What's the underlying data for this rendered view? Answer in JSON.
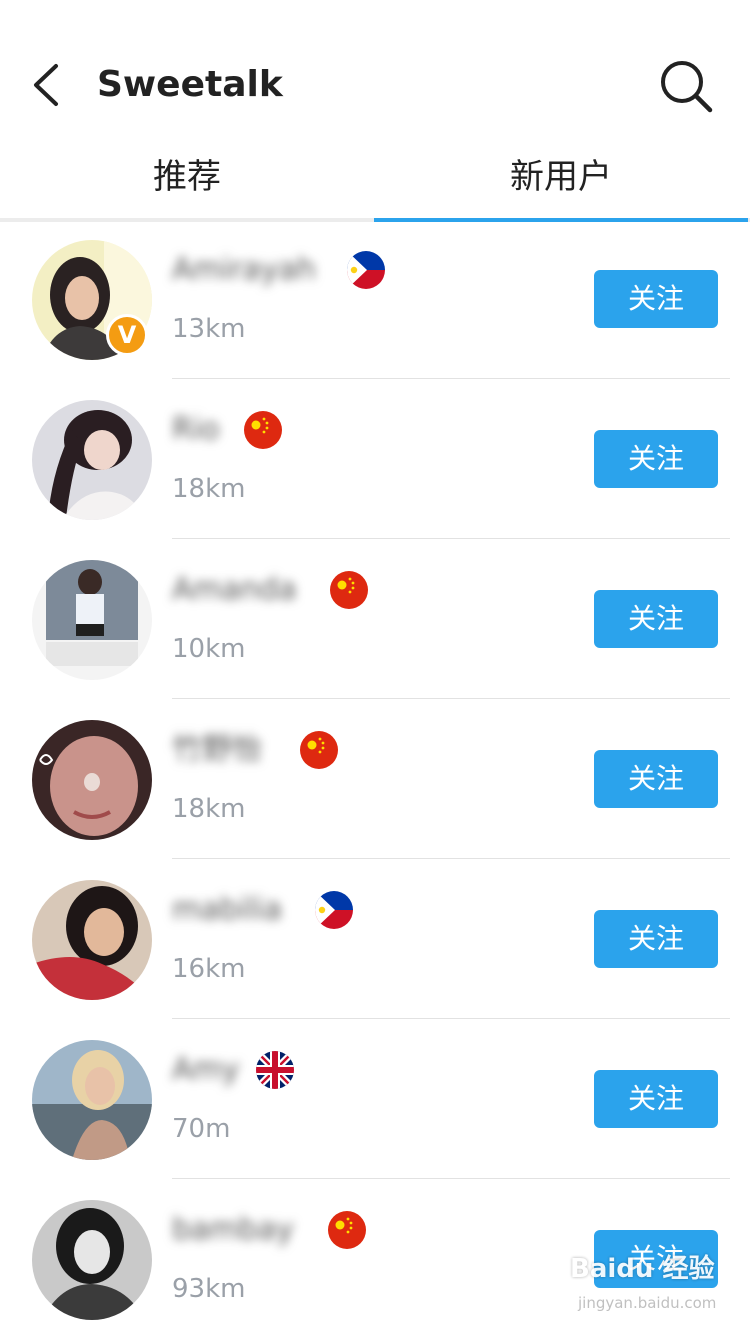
{
  "header": {
    "title": "Sweetalk"
  },
  "tabs": [
    {
      "label": "推荐"
    },
    {
      "label": "新用户"
    }
  ],
  "users": [
    {
      "name": "Amirayah",
      "flag": "philippines",
      "distance": "13km",
      "vip_badge": "V",
      "follow_label": "关注"
    },
    {
      "name": "Rio",
      "flag": "china",
      "distance": "18km",
      "follow_label": "关注"
    },
    {
      "name": "Amanda",
      "flag": "china",
      "distance": "10km",
      "follow_label": "关注"
    },
    {
      "name": "竹野怡",
      "flag": "china",
      "distance": "18km",
      "follow_label": "关注"
    },
    {
      "name": "mabilia",
      "flag": "philippines",
      "distance": "16km",
      "follow_label": "关注"
    },
    {
      "name": "Amy",
      "flag": "uk",
      "distance": "70m",
      "follow_label": "关注"
    },
    {
      "name": "bambay",
      "flag": "china",
      "distance": "93km",
      "follow_label": "关注"
    }
  ],
  "watermark": {
    "text": "Baidu 经验",
    "sub": "jingyan.baidu.com"
  },
  "colors": {
    "accent": "#2ba3ec",
    "vip": "#f49c12"
  }
}
